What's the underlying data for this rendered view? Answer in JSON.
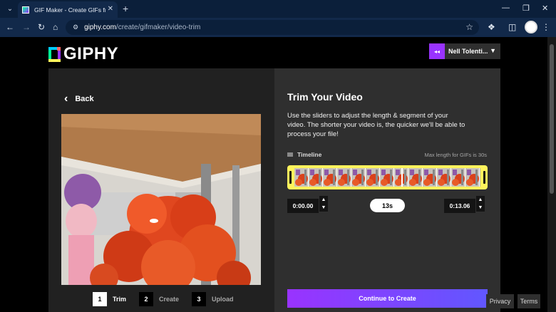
{
  "browser": {
    "tab_title": "GIF Maker - Create GIFs from V",
    "url_host": "giphy.com",
    "url_path": "/create/gifmaker/video-trim"
  },
  "header": {
    "logo_text": "GIPHY",
    "user_initials": "◂◂",
    "user_name": "Nell Tolenti..."
  },
  "left": {
    "back_label": "Back",
    "steps": [
      {
        "num": "1",
        "label": "Trim"
      },
      {
        "num": "2",
        "label": "Create"
      },
      {
        "num": "3",
        "label": "Upload"
      }
    ]
  },
  "right": {
    "title": "Trim Your Video",
    "description": "Use the sliders to adjust the length & segment of your video. The shorter your video is, the quicker we'll be able to process your file!",
    "timeline_label": "Timeline",
    "max_length": "Max length for GIFs is 30s",
    "start_time": "0:00.00",
    "duration": "13s",
    "end_time": "0:13.06",
    "cta_label": "Continue to Create"
  },
  "footer": {
    "privacy": "Privacy",
    "terms": "Terms"
  },
  "colors": {
    "accent_purple": "#9933ff",
    "timeline_yellow": "#fff35c",
    "panel_dark": "#212121",
    "panel_mid": "#2f2f2f"
  }
}
